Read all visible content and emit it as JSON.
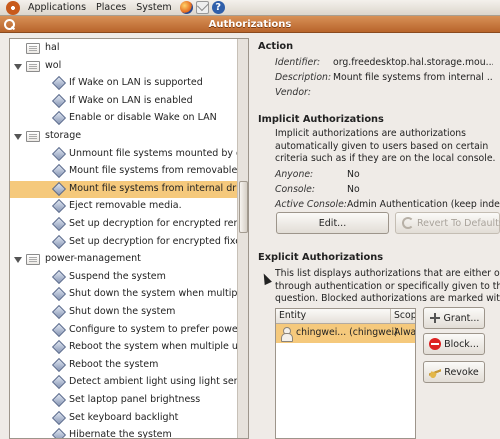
{
  "panel": {
    "menus": [
      "Applications",
      "Places",
      "System"
    ]
  },
  "window": {
    "title": "Authorizations"
  },
  "tree": [
    {
      "label": "hal",
      "kind": "folder",
      "depth": 0,
      "expander": false
    },
    {
      "label": "wol",
      "kind": "folder",
      "depth": 0,
      "expander": true
    },
    {
      "label": "If Wake on LAN is supported",
      "kind": "action",
      "depth": 1
    },
    {
      "label": "If Wake on LAN is enabled",
      "kind": "action",
      "depth": 1
    },
    {
      "label": "Enable or disable Wake on LAN",
      "kind": "action",
      "depth": 1
    },
    {
      "label": "storage",
      "kind": "folder",
      "depth": 0,
      "expander": true
    },
    {
      "label": "Unmount file systems mounted by other",
      "kind": "action",
      "depth": 1
    },
    {
      "label": "Mount file systems from removable drive",
      "kind": "action",
      "depth": 1
    },
    {
      "label": "Mount file systems from internal drives.",
      "kind": "action",
      "depth": 1,
      "selected": true
    },
    {
      "label": "Eject removable media.",
      "kind": "action",
      "depth": 1
    },
    {
      "label": "Set up decryption for encrypted removab",
      "kind": "action",
      "depth": 1
    },
    {
      "label": "Set up decryption for encrypted fixed sto",
      "kind": "action",
      "depth": 1
    },
    {
      "label": "power-management",
      "kind": "folder",
      "depth": 0,
      "expander": true
    },
    {
      "label": "Suspend the system",
      "kind": "action",
      "depth": 1
    },
    {
      "label": "Shut down the system when multiple use",
      "kind": "action",
      "depth": 1
    },
    {
      "label": "Shut down the system",
      "kind": "action",
      "depth": 1
    },
    {
      "label": "Configure to system to prefer power savi",
      "kind": "action",
      "depth": 1
    },
    {
      "label": "Reboot the system when multiple users a",
      "kind": "action",
      "depth": 1
    },
    {
      "label": "Reboot the system",
      "kind": "action",
      "depth": 1
    },
    {
      "label": "Detect ambient light using light sensor",
      "kind": "action",
      "depth": 1
    },
    {
      "label": "Set laptop panel brightness",
      "kind": "action",
      "depth": 1
    },
    {
      "label": "Set keyboard backlight",
      "kind": "action",
      "depth": 1
    },
    {
      "label": "Hibernate the system",
      "kind": "action",
      "depth": 1
    }
  ],
  "action": {
    "heading": "Action",
    "identifier_label": "Identifier:",
    "identifier_value": "org.freedesktop.hal.storage.mou...",
    "description_label": "Description:",
    "description_value": "Mount file systems from internal ...",
    "vendor_label": "Vendor:",
    "vendor_value": ""
  },
  "implicit": {
    "heading": "Implicit Authorizations",
    "desc_lines": [
      "Implicit authorizations are authorizations",
      "automatically given to users based on certain",
      "criteria such as if they are on the local console."
    ],
    "anyone_label": "Anyone:",
    "anyone_value": "No",
    "console_label": "Console:",
    "console_value": "No",
    "active_label": "Active Console:",
    "active_value": "Admin Authentication (keep indefi",
    "edit_button": "Edit...",
    "revert_button": "Revert To Defaults"
  },
  "explicit": {
    "heading": "Explicit Authorizations",
    "desc_lines": [
      "This list displays authorizations that are either ob",
      "through authentication or specifically given to th",
      "question. Blocked authorizations are marked wit"
    ],
    "columns": [
      "Entity",
      "Scope"
    ],
    "rows": [
      {
        "entity": "chingwei... (chingwei)",
        "scope": "Alway"
      }
    ],
    "grant_button": "Grant...",
    "block_button": "Block...",
    "revoke_button": "Revoke"
  },
  "colors": {
    "selection": "#f5c97c",
    "titlebar": "#c97a3e"
  }
}
